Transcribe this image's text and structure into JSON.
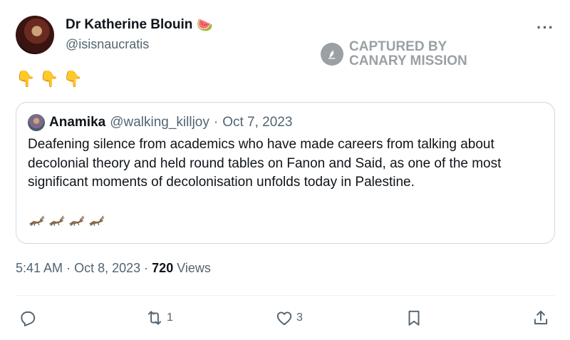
{
  "author": {
    "display_name": "Dr Katherine Blouin",
    "name_emoji": "🍉",
    "handle": "@isisnaucratis"
  },
  "watermark": {
    "line1": "CAPTURED BY",
    "line2": "CANARY MISSION"
  },
  "tweet_emojis": [
    "👇",
    "👇",
    "👇"
  ],
  "quoted_tweet": {
    "author_name": "Anamika",
    "author_handle": "@walking_killjoy",
    "separator": "·",
    "date": "Oct 7, 2023",
    "text": "Deafening silence from academics who have made careers from talking about decolonial theory and held round tables on Fanon and Said, as one of the most significant moments of decolonisation unfolds today in Palestine.",
    "emoji_count": 4
  },
  "timestamp": {
    "time": "5:41 AM",
    "separator": "·",
    "date": "Oct 8, 2023",
    "separator2": "·",
    "views_count": "720",
    "views_label": "Views"
  },
  "actions": {
    "reply_count": "",
    "retweet_count": "1",
    "like_count": "3"
  },
  "colors": {
    "text_primary": "#0f1419",
    "text_secondary": "#536471",
    "border": "#cfd9de",
    "watermark": "#9aa0a4"
  }
}
